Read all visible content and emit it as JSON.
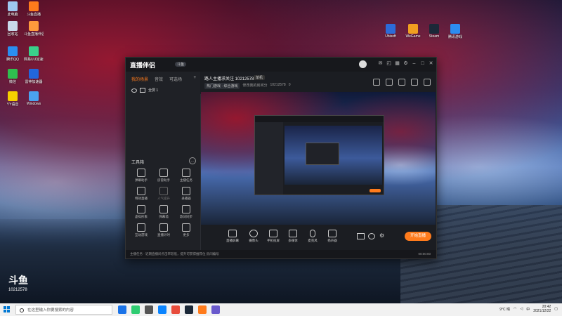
{
  "desktop_icons": [
    {
      "label": "此电脑",
      "color": "#9ec8f0"
    },
    {
      "label": "斗鱼直播",
      "color": "#ff7b1c"
    },
    {
      "label": "回收站",
      "color": "#c9d8ea"
    },
    {
      "label": "斗鱼直播伴侣",
      "color": "#ff9a3c"
    },
    {
      "label": "腾讯QQ",
      "color": "#2a8ef0"
    },
    {
      "label": "网易UU加速器",
      "color": "#3ad08a"
    },
    {
      "label": "微信",
      "color": "#2fbf4f"
    },
    {
      "label": "雷神加速器",
      "color": "#2266dd"
    },
    {
      "label": "YY语音",
      "color": "#f5d000"
    },
    {
      "label": "Windows",
      "color": "#4aa2ee"
    },
    {
      "label": "Ubisoft",
      "color": "#2c6bd8"
    },
    {
      "label": "WeGame",
      "color": "#f0a020"
    },
    {
      "label": "Steam",
      "color": "#1b2838"
    },
    {
      "label": "腾讯游戏",
      "color": "#2c8cf0"
    }
  ],
  "douyu_watermark": {
    "brand": "斗鱼",
    "room": "10212578"
  },
  "app": {
    "brand": "直播伴侣",
    "brand_badge": "斗鱼",
    "titlebar_icons": [
      "message-icon",
      "gift-icon",
      "grid-icon",
      "settings-icon",
      "minimize-icon",
      "maximize-icon",
      "close-icon"
    ]
  },
  "sidebar": {
    "tabs": [
      "我的场景",
      "音效",
      "可选场",
      "+"
    ],
    "scene_name": "全屏 1",
    "tools_title": "工具箱",
    "tools": [
      {
        "label": "弹幕助手",
        "dim": false
      },
      {
        "label": "房管助手",
        "dim": false
      },
      {
        "label": "主播任务",
        "dim": false
      },
      {
        "label": "特效直播",
        "dim": false
      },
      {
        "label": "人气提升",
        "dim": true
      },
      {
        "label": "录播器",
        "dim": false
      },
      {
        "label": "虚拟形象",
        "dim": false
      },
      {
        "label": "弹幕墙",
        "dim": false
      },
      {
        "label": "歌词同步",
        "dim": false
      },
      {
        "label": "互动游戏",
        "dim": false
      },
      {
        "label": "直播计时",
        "dim": false
      },
      {
        "label": "更多",
        "dim": false
      }
    ]
  },
  "room": {
    "title": "路人主播求关注 10212578",
    "tag": "单机",
    "category": "热门游戏 · 综合游戏",
    "pick": "修改我的房间分",
    "room_id": "10212578",
    "fans": "0"
  },
  "controls": [
    {
      "label": "直播屏幕",
      "icon": "screen-icon"
    },
    {
      "label": "摄像头",
      "icon": "camera-icon"
    },
    {
      "label": "手机投屏",
      "icon": "phone-cast-icon"
    },
    {
      "label": "多媒体",
      "icon": "media-icon"
    },
    {
      "label": "麦克风",
      "icon": "mic-icon"
    },
    {
      "label": "扬声器",
      "icon": "speaker-icon"
    }
  ],
  "go_live": "开始直播",
  "status": {
    "left": "主播任务 · 近期直播间点击率较低，提升可获得推荐位    房间编号",
    "right": "00:00:00"
  },
  "taskbar": {
    "search_placeholder": "在这里输入你要搜索的内容",
    "apps": [
      "#1a73e8",
      "#2ecc71",
      "#555555",
      "#0a84ff",
      "#e74c3c",
      "#1b2838",
      "#ff7b1c",
      "#6a5acd"
    ],
    "weather": "9°C 晴",
    "ime": "中",
    "time": "20:42",
    "date": "2021/12/22"
  }
}
